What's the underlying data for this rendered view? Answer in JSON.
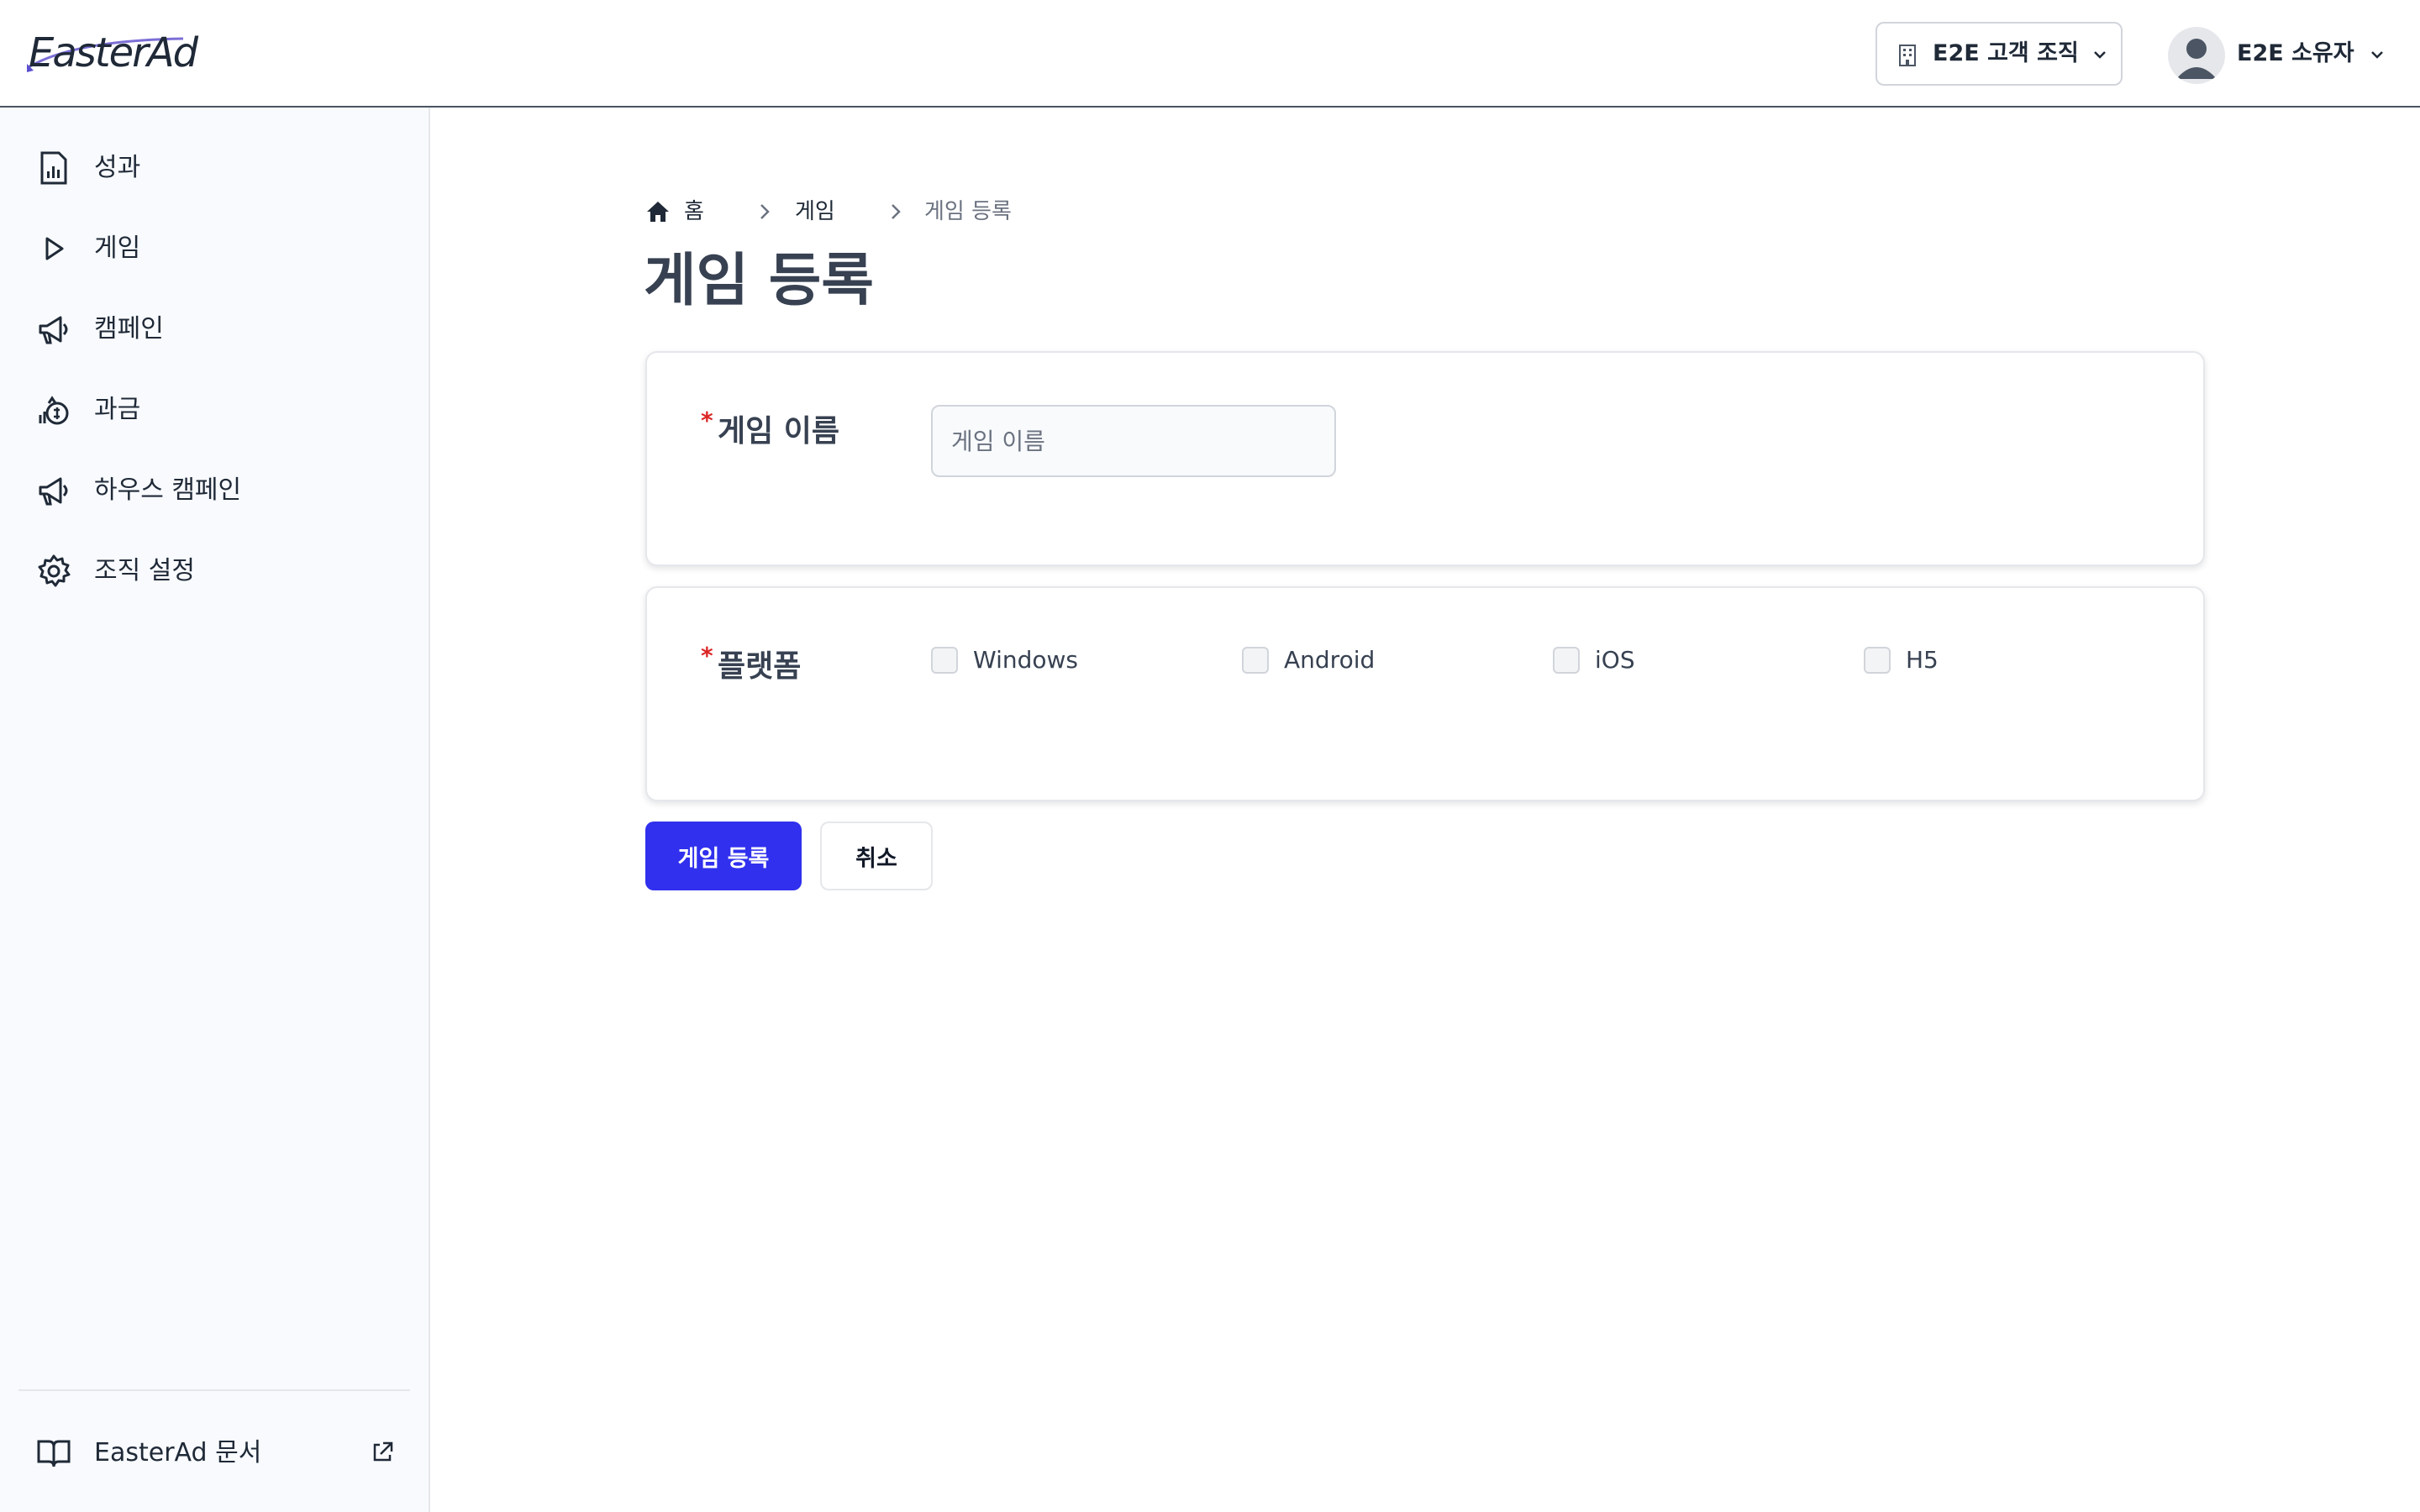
{
  "header": {
    "logo_text": "EasterAd",
    "org_selector": {
      "label": "E2E 고객 조직",
      "icon": "building-icon"
    },
    "user_menu": {
      "name": "E2E 소유자",
      "icon": "avatar-icon"
    }
  },
  "sidebar": {
    "items": [
      {
        "label": "성과",
        "icon": "report-chart-icon"
      },
      {
        "label": "게임",
        "icon": "play-icon"
      },
      {
        "label": "캠페인",
        "icon": "megaphone-icon"
      },
      {
        "label": "과금",
        "icon": "coins-icon"
      },
      {
        "label": "하우스 캠페인",
        "icon": "megaphone-icon"
      },
      {
        "label": "조직 설정",
        "icon": "gear-icon"
      }
    ],
    "docs_link": {
      "label": "EasterAd 문서",
      "icon": "book-icon",
      "ext_icon": "external-link-icon"
    }
  },
  "breadcrumb": {
    "home": "홈",
    "level1": "게임",
    "current": "게임 등록"
  },
  "page": {
    "title": "게임 등록"
  },
  "form": {
    "required_mark": "*",
    "name_field": {
      "label": "게임 이름",
      "placeholder": "게임 이름",
      "value": ""
    },
    "platform_field": {
      "label": "플랫폼",
      "options": [
        {
          "label": "Windows",
          "checked": false
        },
        {
          "label": "Android",
          "checked": false
        },
        {
          "label": "iOS",
          "checked": false
        },
        {
          "label": "H5",
          "checked": false
        }
      ]
    }
  },
  "actions": {
    "submit_label": "게임 등록",
    "cancel_label": "취소"
  },
  "colors": {
    "primary": "#3030ee",
    "required": "#dc2626",
    "sidebar_bg": "#f8fafd"
  }
}
